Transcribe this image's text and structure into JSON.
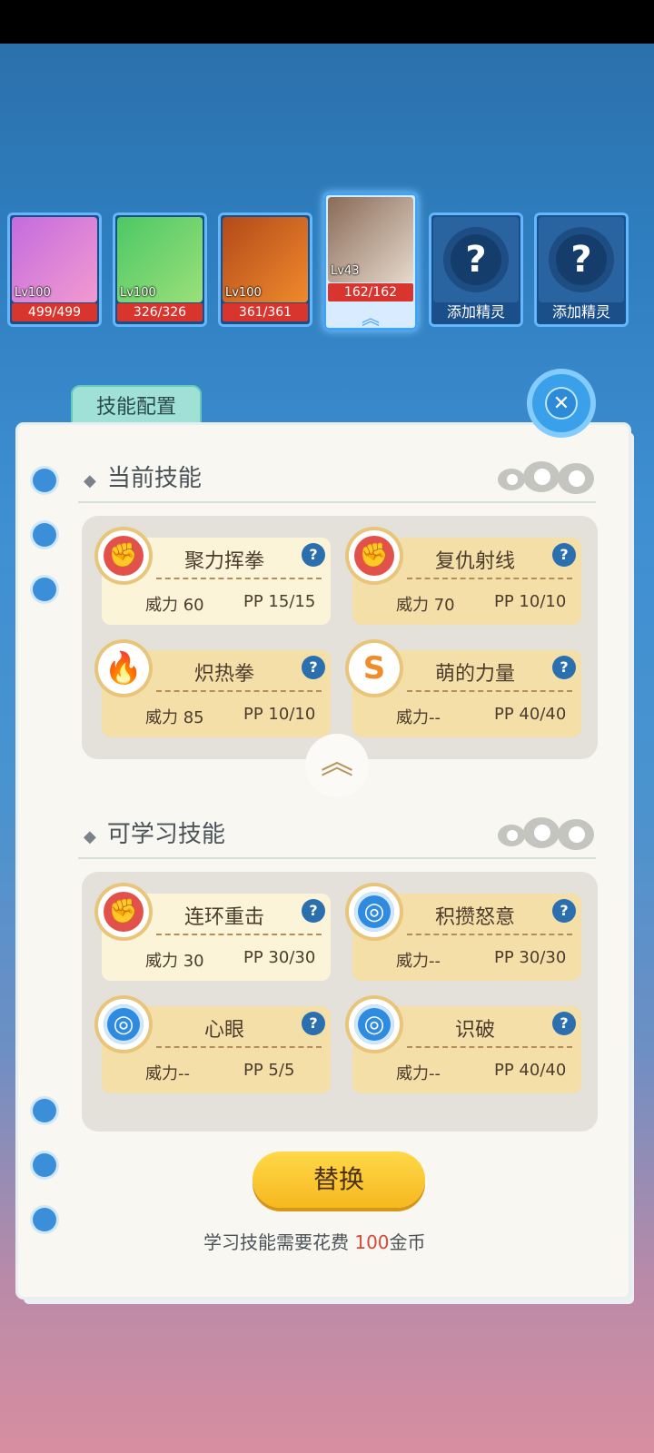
{
  "team": [
    {
      "level": "Lv100",
      "hp": "499/499",
      "colors": [
        "#c46bdf",
        "#f29ad0"
      ]
    },
    {
      "level": "Lv100",
      "hp": "326/326",
      "colors": [
        "#4cc864",
        "#9be07a"
      ]
    },
    {
      "level": "Lv100",
      "hp": "361/361",
      "colors": [
        "#b24a1a",
        "#f08a2c"
      ]
    },
    {
      "level": "Lv43",
      "hp": "162/162",
      "colors": [
        "#8a6a57",
        "#e6d9cc"
      ],
      "selected": true
    },
    {
      "add_label": "添加精灵"
    },
    {
      "add_label": "添加精灵"
    }
  ],
  "panel": {
    "tab_label": "技能配置",
    "close_icon": "close-icon",
    "current_section_title": "当前技能",
    "learnable_section_title": "可学习技能",
    "replace_button": "替换",
    "cost_prefix": "学习技能需要花费",
    "cost_amount": "100",
    "cost_suffix": "金币"
  },
  "current_skills": [
    {
      "name": "聚力挥拳",
      "power": "威力 60",
      "pp": "PP 15/15",
      "icon": "fist-icon",
      "icon_color": "#e2524a"
    },
    {
      "name": "复仇射线",
      "power": "威力 70",
      "pp": "PP 10/10",
      "icon": "fist-icon",
      "icon_color": "#e2524a"
    },
    {
      "name": "炽热拳",
      "power": "威力 85",
      "pp": "PP 10/10",
      "icon": "fire-icon",
      "icon_color": "#f05b45"
    },
    {
      "name": "萌的力量",
      "power": "威力--",
      "pp": "PP 40/40",
      "icon": "swirl-icon",
      "icon_color": "#f08c2a"
    }
  ],
  "learnable_skills": [
    {
      "name": "连环重击",
      "power": "威力 30",
      "pp": "PP 30/30",
      "icon": "fist-icon",
      "icon_color": "#e2524a"
    },
    {
      "name": "积攒怒意",
      "power": "威力--",
      "pp": "PP 30/30",
      "icon": "target-icon",
      "icon_color": "#2f8be0"
    },
    {
      "name": "心眼",
      "power": "威力--",
      "pp": "PP 5/5",
      "icon": "target-icon",
      "icon_color": "#2f8be0"
    },
    {
      "name": "识破",
      "power": "威力--",
      "pp": "PP 40/40",
      "icon": "target-icon",
      "icon_color": "#2f8be0"
    }
  ]
}
